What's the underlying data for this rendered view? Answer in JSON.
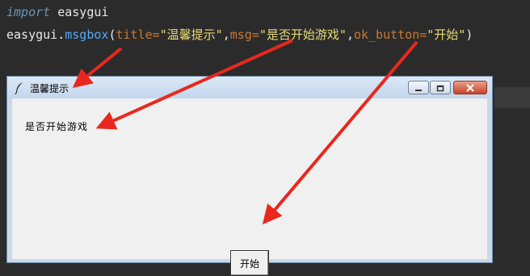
{
  "editor": {
    "line1": {
      "keyword": "import",
      "rest": " easygui"
    },
    "line2": {
      "module": "easygui.",
      "func": "msgbox",
      "open": "(",
      "p1": "title=",
      "v1": "\"温馨提示\"",
      "c1": ",",
      "p2": "msg=",
      "v2": "\"是否开始游戏\"",
      "c2": ",",
      "p3": "ok_button=",
      "v3": "\"开始\"",
      "close": ")"
    }
  },
  "dialog": {
    "title": "温馨提示",
    "message": "是否开始游戏",
    "ok_button": "开始",
    "icons": {
      "title": "feather-icon",
      "minimize": "minimize-icon",
      "maximize": "maximize-icon",
      "close": "close-icon"
    }
  },
  "colors": {
    "arrow": "#e8281e",
    "editor_bg": "#2b2b2b"
  }
}
